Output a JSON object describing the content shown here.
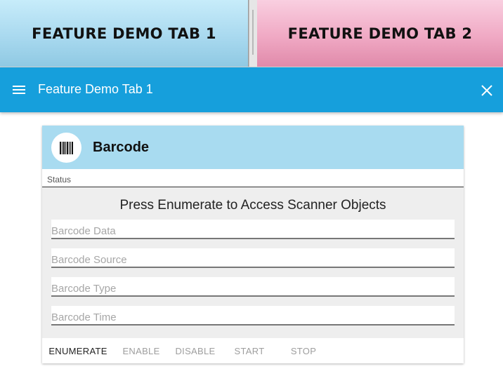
{
  "tabs": [
    {
      "label": "FEATURE DEMO TAB 1"
    },
    {
      "label": "FEATURE DEMO TAB 2"
    }
  ],
  "appbar": {
    "title": "Feature Demo Tab 1",
    "menu_icon": "hamburger-menu-icon",
    "close_icon": "close-icon",
    "color": "#169fdc"
  },
  "card": {
    "icon": "barcode-icon",
    "title": "Barcode",
    "status_label": "Status",
    "message": "Press Enumerate to Access Scanner Objects",
    "fields": {
      "barcode_data": {
        "placeholder": "Barcode Data",
        "value": ""
      },
      "barcode_source": {
        "placeholder": "Barcode Source",
        "value": ""
      },
      "barcode_type": {
        "placeholder": "Barcode Type",
        "value": ""
      },
      "barcode_time": {
        "placeholder": "Barcode Time",
        "value": ""
      }
    },
    "buttons": {
      "enumerate": "ENUMERATE",
      "enable": "ENABLE",
      "disable": "DISABLE",
      "start": "START",
      "stop": "STOP"
    }
  },
  "colors": {
    "tab1": "#a9d9ef",
    "tab2": "#f0a9c4",
    "card_header": "#a8dbf0"
  }
}
